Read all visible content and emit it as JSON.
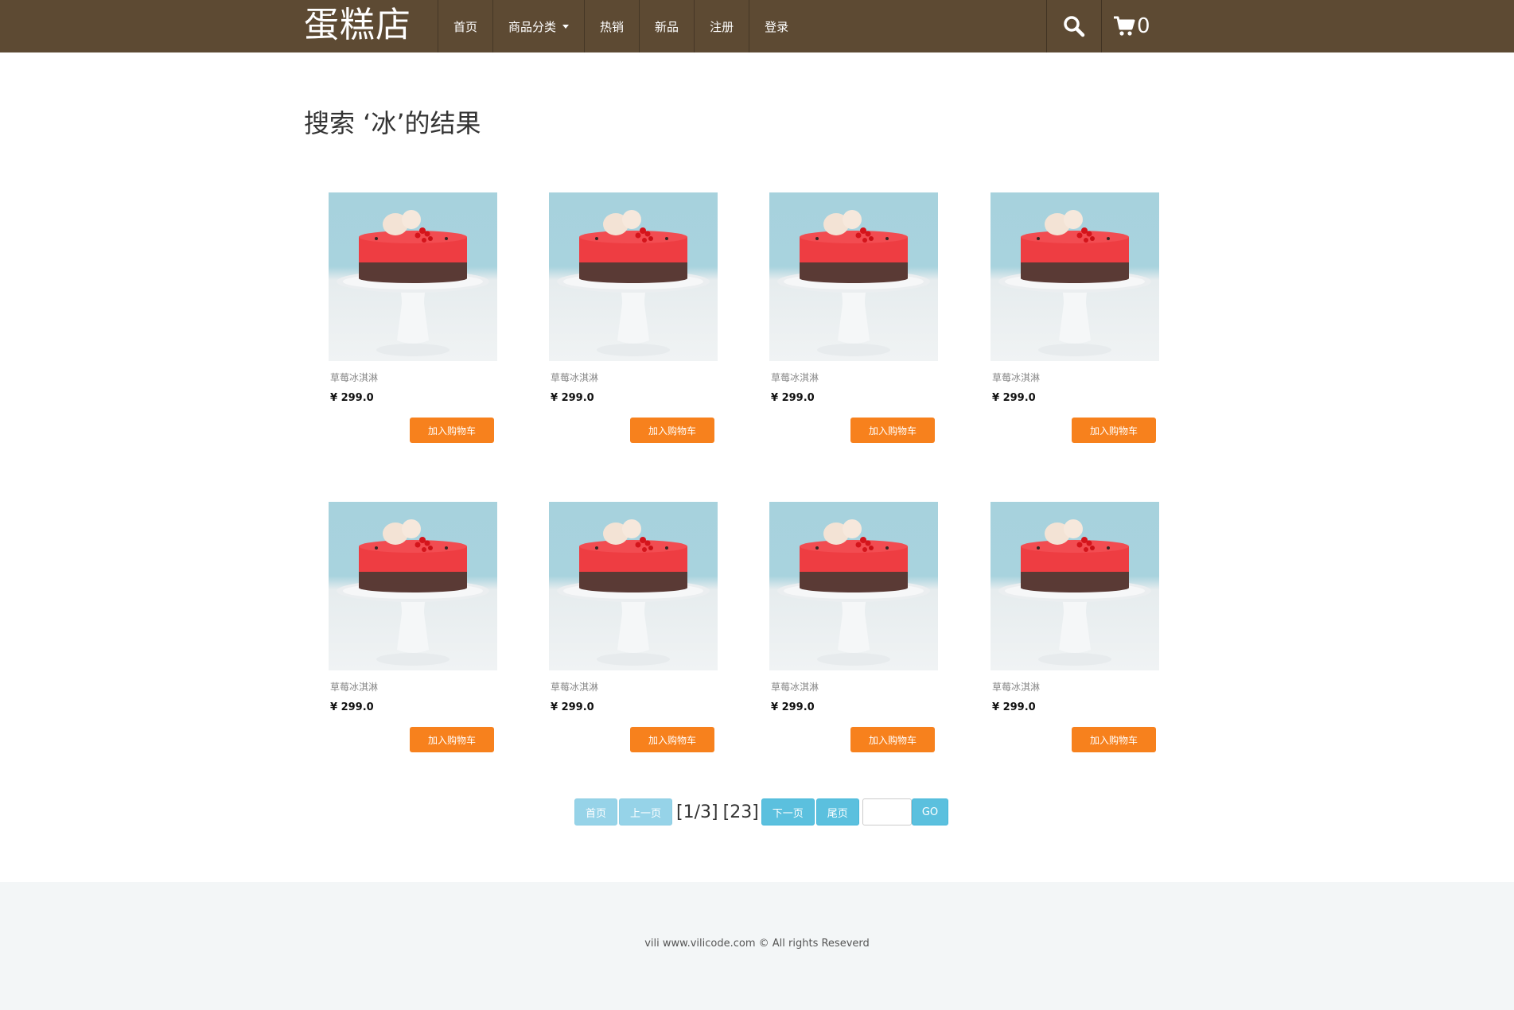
{
  "header": {
    "brand": "蛋糕店",
    "nav": [
      {
        "label": "首页"
      },
      {
        "label": "商品分类"
      },
      {
        "label": "热销"
      },
      {
        "label": "新品"
      },
      {
        "label": "注册"
      },
      {
        "label": "登录"
      }
    ],
    "cart_count": "0"
  },
  "search": {
    "title": "搜索 ‘冰’的结果"
  },
  "products": [
    {
      "name": "草莓冰淇淋",
      "price": "¥ 299.0",
      "button": "加入购物车"
    },
    {
      "name": "草莓冰淇淋",
      "price": "¥ 299.0",
      "button": "加入购物车"
    },
    {
      "name": "草莓冰淇淋",
      "price": "¥ 299.0",
      "button": "加入购物车"
    },
    {
      "name": "草莓冰淇淋",
      "price": "¥ 299.0",
      "button": "加入购物车"
    },
    {
      "name": "草莓冰淇淋",
      "price": "¥ 299.0",
      "button": "加入购物车"
    },
    {
      "name": "草莓冰淇淋",
      "price": "¥ 299.0",
      "button": "加入购物车"
    },
    {
      "name": "草莓冰淇淋",
      "price": "¥ 299.0",
      "button": "加入购物车"
    },
    {
      "name": "草莓冰淇淋",
      "price": "¥ 299.0",
      "button": "加入购物车"
    }
  ],
  "pagination": {
    "first": "首页",
    "prev": "上一页",
    "page_info": "[1/3]",
    "total": "[23]",
    "next": "下一页",
    "last": "尾页",
    "jump_value": "",
    "go": "GO"
  },
  "footer": {
    "text": "vili www.vilicode.com © All rights Reseverd"
  },
  "colors": {
    "navbar": "#5d4a33",
    "accent_button": "#f7811d",
    "pager_button": "#5bc0de",
    "footer_bg": "#f3f6f7"
  }
}
